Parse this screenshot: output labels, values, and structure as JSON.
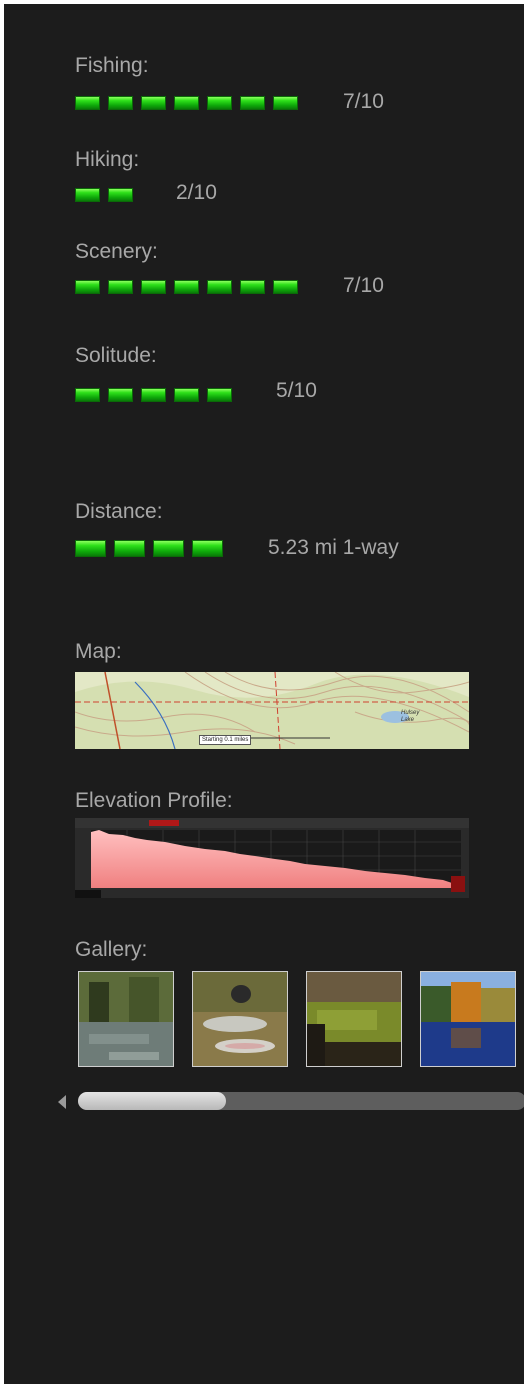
{
  "ratings": [
    {
      "label": "Fishing:",
      "score": 7,
      "display": "7/10"
    },
    {
      "label": "Hiking:",
      "score": 2,
      "display": "2/10"
    },
    {
      "label": "Scenery:",
      "score": 7,
      "display": "7/10"
    },
    {
      "label": "Solitude:",
      "score": 5,
      "display": "5/10"
    }
  ],
  "distance": {
    "label": "Distance:",
    "bars": 4,
    "display": "5.23 mi 1-way"
  },
  "map": {
    "label": "Map:",
    "place_label": "Hulsey Lake",
    "marker_text": "Starting 0.1 miles"
  },
  "elevation": {
    "label": "Elevation Profile:"
  },
  "gallery": {
    "label": "Gallery:",
    "thumbnails": [
      "creek-photo",
      "fish-catch-photo",
      "river-bank-photo",
      "autumn-pond-photo"
    ],
    "scroll_fraction": 0.33
  },
  "colors": {
    "panel_bg": "#1c1c1c",
    "text": "#a8a8a8",
    "pip_green": "#2ee01a"
  }
}
